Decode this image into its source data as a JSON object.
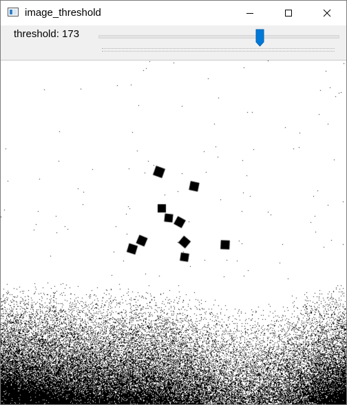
{
  "window": {
    "title": "image_threshold",
    "app_icon": "opencv-window-icon",
    "controls": {
      "minimize_icon": "minimize-icon",
      "maximize_icon": "maximize-icon",
      "close_icon": "close-icon"
    }
  },
  "trackbar": {
    "name": "threshold",
    "value": 173,
    "label": "threshold: 173",
    "min": 0,
    "max": 255,
    "thumb_color": "#0078d7"
  },
  "image": {
    "content": "binary thresholded image",
    "foreground_color": "#000000",
    "background_color": "#ffffff"
  }
}
